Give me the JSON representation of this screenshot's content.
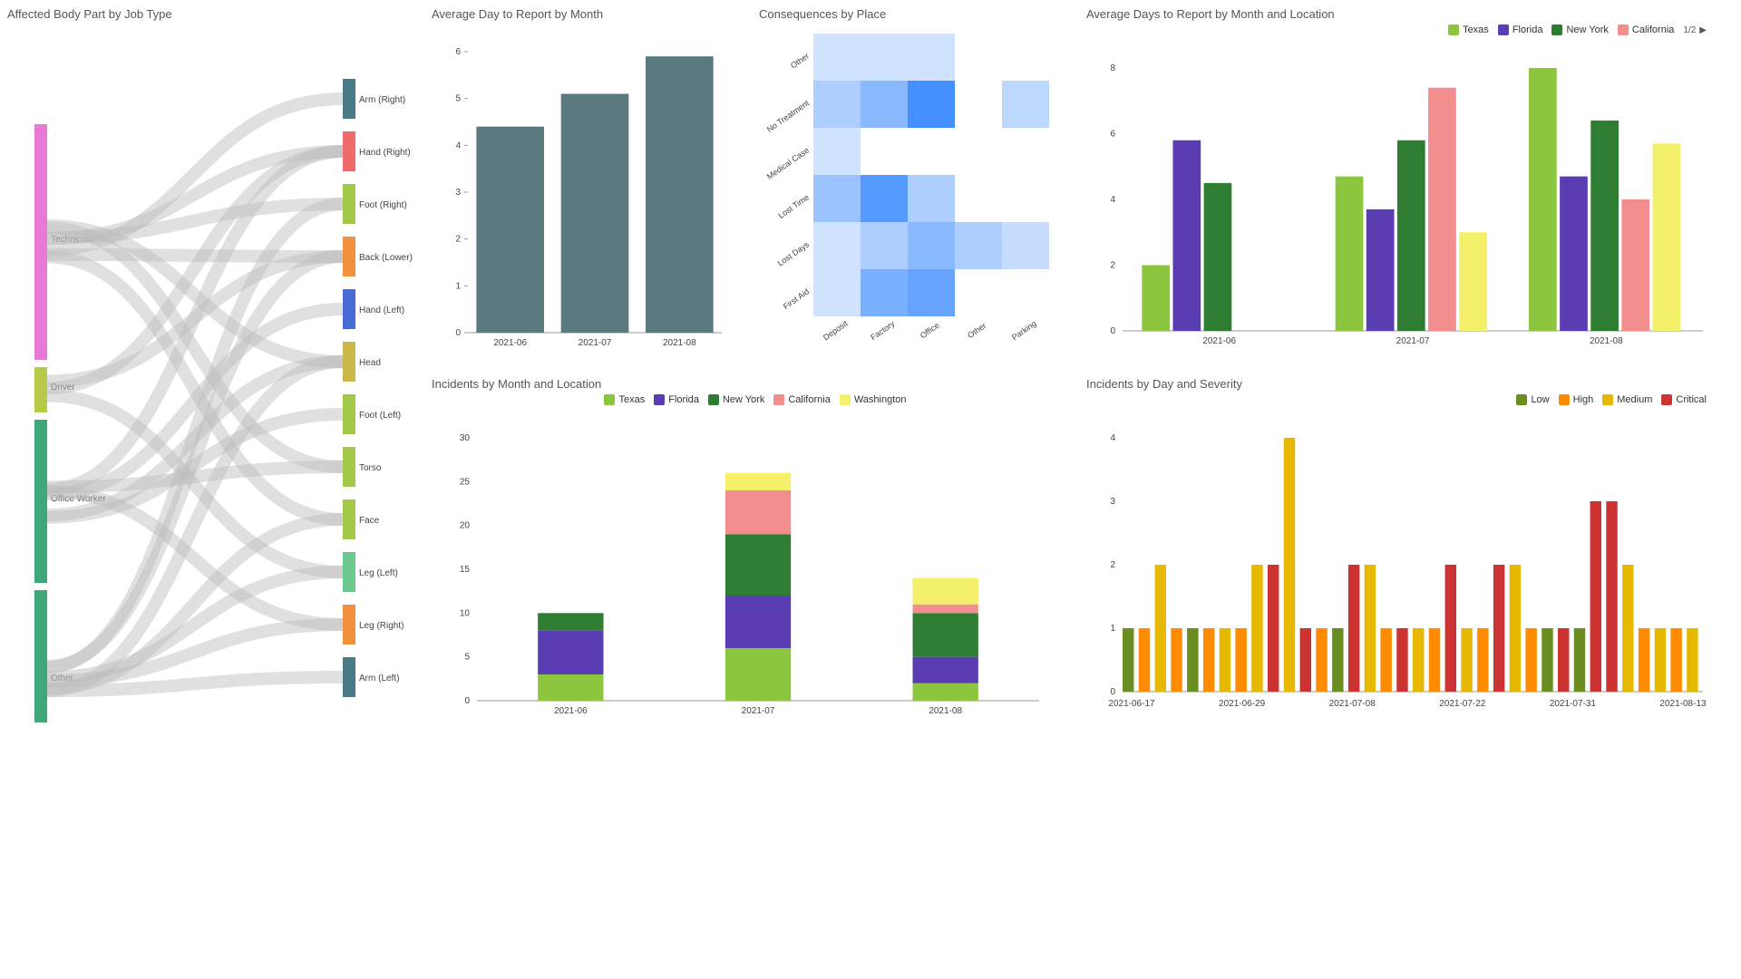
{
  "sankey": {
    "title": "Affected Body Part by Job Type",
    "sources": [
      "Technician",
      "Driver",
      "Office Worker",
      "Other"
    ],
    "targets": [
      "Arm (Right)",
      "Hand (Right)",
      "Foot (Right)",
      "Back (Lower)",
      "Hand (Left)",
      "Head",
      "Foot (Left)",
      "Torso",
      "Face",
      "Leg (Left)",
      "Leg (Right)",
      "Arm (Left)"
    ]
  },
  "avg_report": {
    "title": "Average Day to Report by Month",
    "categories": [
      "2021-06",
      "2021-07",
      "2021-08"
    ],
    "values": [
      4.4,
      5.1,
      5.9
    ],
    "ylim": [
      0,
      6
    ]
  },
  "heat": {
    "title": "Consequences by Place",
    "rows": [
      "Other",
      "No Treatment",
      "Medical Case",
      "Lost Time",
      "Lost Days",
      "First Aid"
    ],
    "cols": [
      "Deposit",
      "Factory",
      "Office",
      "Other",
      "Parking"
    ],
    "values": [
      [
        0.1,
        0.1,
        0.1,
        0,
        0
      ],
      [
        0.3,
        0.5,
        0.9,
        0,
        0.2
      ],
      [
        0.1,
        0,
        0,
        0,
        0
      ],
      [
        0.4,
        0.8,
        0.3,
        0,
        0
      ],
      [
        0.1,
        0.3,
        0.5,
        0.3,
        0.15
      ],
      [
        0.1,
        0.6,
        0.7,
        0,
        0
      ]
    ]
  },
  "avg_loc": {
    "title": "Average Days to Report by Month and Location",
    "legend_page": "1/2",
    "categories": [
      "2021-06",
      "2021-07",
      "2021-08"
    ],
    "series": [
      {
        "name": "Texas",
        "color": "#8cc63f",
        "values": [
          2.0,
          4.7,
          8.0
        ]
      },
      {
        "name": "Florida",
        "color": "#5b3db3",
        "values": [
          5.8,
          3.7,
          4.7
        ]
      },
      {
        "name": "New York",
        "color": "#2e7d32",
        "values": [
          4.5,
          5.8,
          6.4
        ]
      },
      {
        "name": "California",
        "color": "#f28e8e",
        "values": [
          0,
          7.4,
          4.0
        ]
      },
      {
        "name": "Washington",
        "color": "#f5f06a",
        "values": [
          0,
          3.0,
          5.7
        ]
      }
    ],
    "ylim": [
      0,
      8
    ]
  },
  "inc_loc": {
    "title": "Incidents by Month and Location",
    "categories": [
      "2021-06",
      "2021-07",
      "2021-08"
    ],
    "series": [
      {
        "name": "Texas",
        "color": "#8cc63f",
        "values": [
          3,
          6,
          2
        ]
      },
      {
        "name": "Florida",
        "color": "#5b3db3",
        "values": [
          5,
          6,
          3
        ]
      },
      {
        "name": "New York",
        "color": "#2e7d32",
        "values": [
          2,
          7,
          5
        ]
      },
      {
        "name": "California",
        "color": "#f28e8e",
        "values": [
          0,
          5,
          1
        ]
      },
      {
        "name": "Washington",
        "color": "#f5f06a",
        "values": [
          0,
          2,
          3
        ]
      }
    ],
    "ylim": [
      0,
      30
    ]
  },
  "inc_day": {
    "title": "Incidents by Day and Severity",
    "xticks": [
      "2021-06-17",
      "2021-06-29",
      "2021-07-08",
      "2021-07-22",
      "2021-07-31",
      "2021-08-13"
    ],
    "series": [
      {
        "name": "Low",
        "color": "#6b8e23"
      },
      {
        "name": "High",
        "color": "#ff8c00"
      },
      {
        "name": "Medium",
        "color": "#e6b800"
      },
      {
        "name": "Critical",
        "color": "#cc3333"
      }
    ],
    "bars": [
      {
        "c": "#6b8e23",
        "v": 1
      },
      {
        "c": "#ff8c00",
        "v": 1
      },
      {
        "c": "#e6b800",
        "v": 2
      },
      {
        "c": "#ff8c00",
        "v": 1
      },
      {
        "c": "#6b8e23",
        "v": 1
      },
      {
        "c": "#ff8c00",
        "v": 1
      },
      {
        "c": "#e6b800",
        "v": 1
      },
      {
        "c": "#ff8c00",
        "v": 1
      },
      {
        "c": "#e6b800",
        "v": 2
      },
      {
        "c": "#cc3333",
        "v": 2
      },
      {
        "c": "#e6b800",
        "v": 4
      },
      {
        "c": "#cc3333",
        "v": 1
      },
      {
        "c": "#ff8c00",
        "v": 1
      },
      {
        "c": "#6b8e23",
        "v": 1
      },
      {
        "c": "#cc3333",
        "v": 2
      },
      {
        "c": "#e6b800",
        "v": 2
      },
      {
        "c": "#ff8c00",
        "v": 1
      },
      {
        "c": "#cc3333",
        "v": 1
      },
      {
        "c": "#e6b800",
        "v": 1
      },
      {
        "c": "#ff8c00",
        "v": 1
      },
      {
        "c": "#cc3333",
        "v": 2
      },
      {
        "c": "#e6b800",
        "v": 1
      },
      {
        "c": "#ff8c00",
        "v": 1
      },
      {
        "c": "#cc3333",
        "v": 2
      },
      {
        "c": "#e6b800",
        "v": 2
      },
      {
        "c": "#ff8c00",
        "v": 1
      },
      {
        "c": "#6b8e23",
        "v": 1
      },
      {
        "c": "#cc3333",
        "v": 1
      },
      {
        "c": "#6b8e23",
        "v": 1
      },
      {
        "c": "#cc3333",
        "v": 3
      },
      {
        "c": "#cc3333",
        "v": 3
      },
      {
        "c": "#e6b800",
        "v": 2
      },
      {
        "c": "#ff8c00",
        "v": 1
      },
      {
        "c": "#e6b800",
        "v": 1
      },
      {
        "c": "#ff8c00",
        "v": 1
      },
      {
        "c": "#e6b800",
        "v": 1
      }
    ],
    "ylim": [
      0,
      4
    ]
  },
  "chart_data": [
    {
      "type": "sankey",
      "title": "Affected Body Part by Job Type",
      "sources": [
        "Technician",
        "Driver",
        "Office Worker",
        "Other"
      ],
      "targets": [
        "Arm (Right)",
        "Hand (Right)",
        "Foot (Right)",
        "Back (Lower)",
        "Hand (Left)",
        "Head",
        "Foot (Left)",
        "Torso",
        "Face",
        "Leg (Left)",
        "Leg (Right)",
        "Arm (Left)"
      ]
    },
    {
      "type": "bar",
      "title": "Average Day to Report by Month",
      "categories": [
        "2021-06",
        "2021-07",
        "2021-08"
      ],
      "values": [
        4.4,
        5.1,
        5.9
      ],
      "xlabel": "",
      "ylabel": "",
      "ylim": [
        0,
        6
      ]
    },
    {
      "type": "heatmap",
      "title": "Consequences by Place",
      "rows": [
        "Other",
        "No Treatment",
        "Medical Case",
        "Lost Time",
        "Lost Days",
        "First Aid"
      ],
      "cols": [
        "Deposit",
        "Factory",
        "Office",
        "Other",
        "Parking"
      ]
    },
    {
      "type": "bar",
      "title": "Average Days to Report by Month and Location",
      "categories": [
        "2021-06",
        "2021-07",
        "2021-08"
      ],
      "series": [
        {
          "name": "Texas",
          "values": [
            2.0,
            4.7,
            8.0
          ]
        },
        {
          "name": "Florida",
          "values": [
            5.8,
            3.7,
            4.7
          ]
        },
        {
          "name": "New York",
          "values": [
            4.5,
            5.8,
            6.4
          ]
        },
        {
          "name": "California",
          "values": [
            0,
            7.4,
            4.0
          ]
        },
        {
          "name": "Washington",
          "values": [
            0,
            3.0,
            5.7
          ]
        }
      ],
      "ylim": [
        0,
        8
      ]
    },
    {
      "type": "bar",
      "title": "Incidents by Month and Location",
      "categories": [
        "2021-06",
        "2021-07",
        "2021-08"
      ],
      "series": [
        {
          "name": "Texas",
          "values": [
            3,
            6,
            2
          ]
        },
        {
          "name": "Florida",
          "values": [
            5,
            6,
            3
          ]
        },
        {
          "name": "New York",
          "values": [
            2,
            7,
            5
          ]
        },
        {
          "name": "California",
          "values": [
            0,
            5,
            1
          ]
        },
        {
          "name": "Washington",
          "values": [
            0,
            2,
            3
          ]
        }
      ],
      "ylim": [
        0,
        30
      ],
      "stacked": true
    },
    {
      "type": "bar",
      "title": "Incidents by Day and Severity",
      "legend": [
        "Low",
        "High",
        "Medium",
        "Critical"
      ],
      "ylim": [
        0,
        4
      ]
    }
  ]
}
